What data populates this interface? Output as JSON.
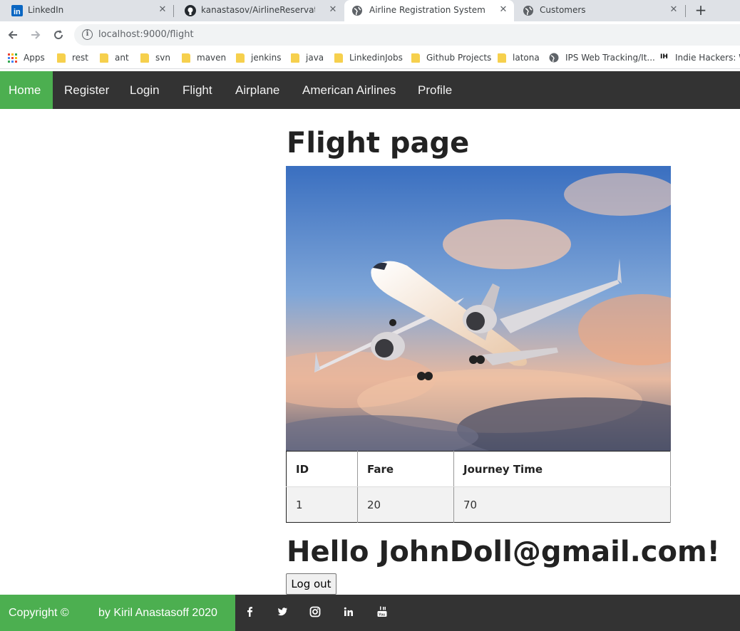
{
  "browser": {
    "tabs": [
      {
        "label": "LinkedIn",
        "icon": "linkedin-icon"
      },
      {
        "label": "kanastasov/AirlineReservationSys",
        "icon": "github-icon"
      },
      {
        "label": "Airline Registration System",
        "icon": "globe-icon",
        "active": true
      },
      {
        "label": "Customers",
        "icon": "globe-icon"
      }
    ],
    "url": "localhost:9000/flight",
    "bookmarks": [
      "Apps",
      "rest",
      "ant",
      "svn",
      "maven",
      "jenkins",
      "java",
      "LinkedinJobs",
      "Github Projects",
      "latona",
      "IPS Web Tracking/It...",
      "Indie Hackers: Wo"
    ]
  },
  "nav": {
    "items": [
      "Home",
      "Register",
      "Login",
      "Flight",
      "Airplane",
      "American Airlines",
      "Profile"
    ],
    "active_color": "#4caf50"
  },
  "page": {
    "title": "Flight page",
    "table": {
      "headers": [
        "ID",
        "Fare",
        "Journey Time"
      ],
      "rows": [
        [
          "1",
          "20",
          "70"
        ]
      ]
    },
    "greeting": "Hello JohnDoll@gmail.com!",
    "logout_label": "Log out"
  },
  "footer": {
    "copyright": "Copyright ©",
    "author": "by Kiril Anastasoff 2020",
    "social": [
      "facebook-icon",
      "twitter-icon",
      "instagram-icon",
      "linkedin-icon",
      "youtube-icon"
    ]
  }
}
